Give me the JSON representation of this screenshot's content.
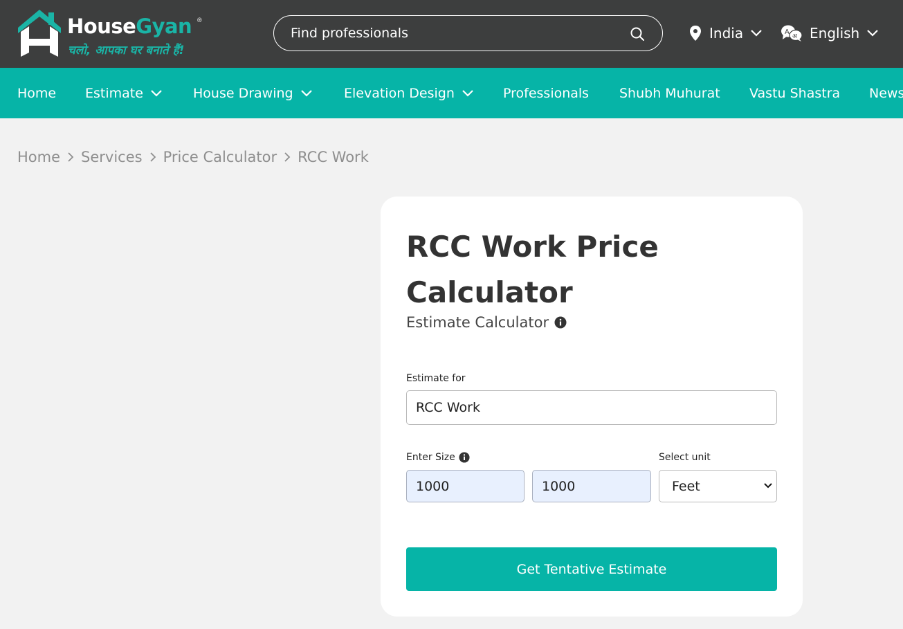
{
  "header": {
    "logo": {
      "brand_white": "House",
      "brand_teal": "Gyan",
      "registered": "®",
      "tagline": "चलो, आपका घर बनाते हैं!"
    },
    "search": {
      "placeholder": "Find professionals",
      "icon": "search-icon"
    },
    "location": {
      "label": "India",
      "icon": "map-pin-icon"
    },
    "language": {
      "label": "English",
      "icon": "translate-icon"
    }
  },
  "nav": {
    "items": [
      {
        "label": "Home",
        "has_dropdown": false
      },
      {
        "label": "Estimate",
        "has_dropdown": true
      },
      {
        "label": "House Drawing",
        "has_dropdown": true
      },
      {
        "label": "Elevation Design",
        "has_dropdown": true
      },
      {
        "label": "Professionals",
        "has_dropdown": false
      },
      {
        "label": "Shubh Muhurat",
        "has_dropdown": false
      },
      {
        "label": "Vastu Shastra",
        "has_dropdown": false
      },
      {
        "label": "News",
        "has_dropdown": false
      }
    ]
  },
  "breadcrumb": [
    "Home",
    "Services",
    "Price Calculator",
    "RCC Work"
  ],
  "calculator": {
    "title": "RCC Work Price Calculator",
    "subtitle": "Estimate Calculator",
    "estimate_for_label": "Estimate for",
    "estimate_for_value": "RCC Work",
    "size_label": "Enter Size",
    "size_length": "1000",
    "size_width": "1000",
    "unit_label": "Select unit",
    "unit_value": "Feet",
    "submit_label": "Get Tentative Estimate"
  },
  "colors": {
    "header_bg": "#3d3e3e",
    "accent": "#06b4a7",
    "page_bg": "#f2f2f2"
  }
}
